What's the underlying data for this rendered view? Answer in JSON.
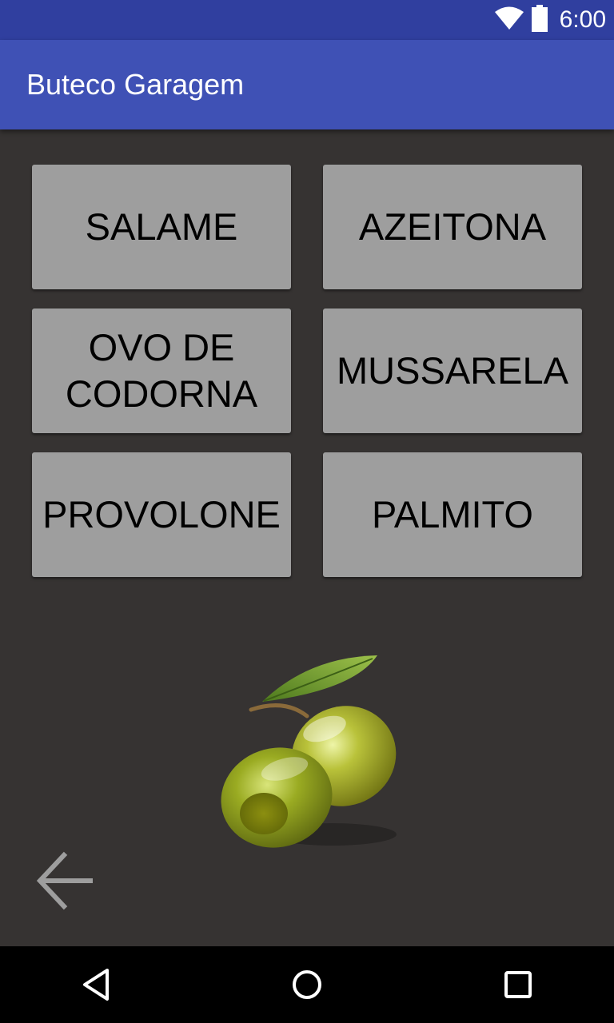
{
  "status_bar": {
    "time": "6:00",
    "icons": [
      "wifi-icon",
      "battery-icon"
    ]
  },
  "app_bar": {
    "title": "Buteco Garagem"
  },
  "buttons": [
    {
      "label": "SALAME"
    },
    {
      "label": "AZEITONA"
    },
    {
      "label": "OVO DE CODORNA"
    },
    {
      "label": "MUSSARELA"
    },
    {
      "label": "PROVOLONE"
    },
    {
      "label": "PALMITO"
    }
  ],
  "image": {
    "icon": "olive-image"
  },
  "back": {
    "icon": "back-arrow-icon"
  },
  "nav_bar": {
    "icons": [
      "back-triangle-icon",
      "home-circle-icon",
      "recents-square-icon"
    ]
  },
  "colors": {
    "status_bar": "#303f9f",
    "app_bar": "#3f51b5",
    "background": "#363332",
    "button": "#9e9e9e",
    "button_text": "#000000",
    "nav_bar": "#000000"
  }
}
